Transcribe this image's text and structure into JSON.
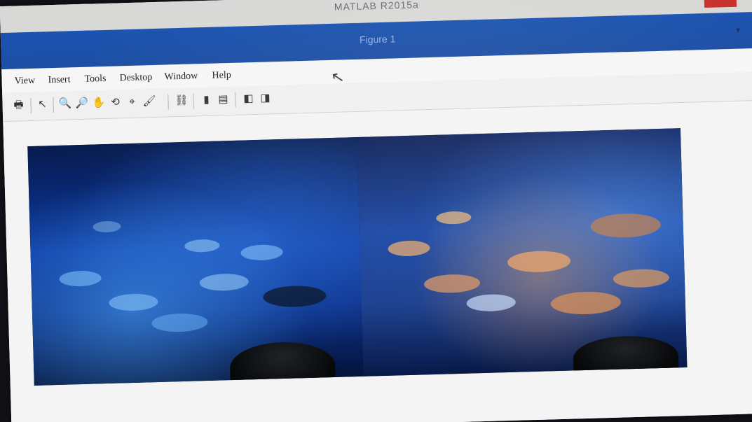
{
  "window": {
    "outer_title": "MATLAB R2015a",
    "figure_title": "Figure 1",
    "close_symbol": "×",
    "figure_menu_symbol": "▾"
  },
  "menu": {
    "items": [
      "View",
      "Insert",
      "Tools",
      "Desktop",
      "Window",
      "Help"
    ]
  },
  "toolbar": {
    "tools": [
      {
        "name": "print-icon",
        "glyph": "🖶"
      },
      {
        "name": "pointer-icon",
        "glyph": "↖"
      },
      {
        "name": "zoom-in-icon",
        "glyph": "🔍"
      },
      {
        "name": "zoom-out-icon",
        "glyph": "🔎"
      },
      {
        "name": "pan-icon",
        "glyph": "✋"
      },
      {
        "name": "rotate-3d-icon",
        "glyph": "⟲"
      },
      {
        "name": "data-cursor-icon",
        "glyph": "⌖"
      },
      {
        "name": "brush-icon",
        "glyph": "🖌"
      },
      {
        "name": "link-icon",
        "glyph": "⛓"
      },
      {
        "name": "colorbar-icon",
        "glyph": "▮"
      },
      {
        "name": "legend-icon",
        "glyph": "▤"
      },
      {
        "name": "hide-plot-tools-icon",
        "glyph": "◧"
      },
      {
        "name": "show-plot-tools-icon",
        "glyph": "◨"
      }
    ]
  },
  "figure": {
    "panels": [
      "left",
      "right"
    ]
  },
  "colors": {
    "titlebar": "#1b53b1",
    "close": "#c9302c",
    "water_dark": "#071b4e",
    "water_bright": "#1a48a6"
  }
}
